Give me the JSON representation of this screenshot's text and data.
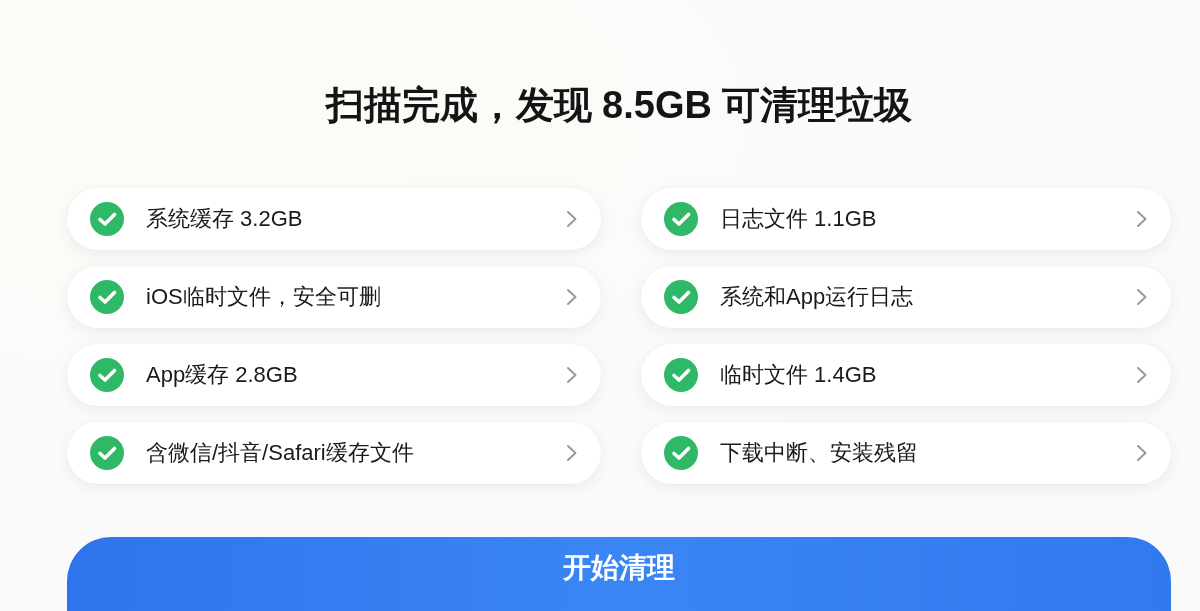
{
  "title": "扫描完成，发现 8.5GB 可清理垃圾",
  "items": [
    {
      "label": "系统缓存 3.2GB",
      "checked": true
    },
    {
      "label": "日志文件 1.1GB",
      "checked": true
    },
    {
      "label": "iOS临时文件，安全可删",
      "checked": true
    },
    {
      "label": "系统和App运行日志",
      "checked": true
    },
    {
      "label": "App缓存 2.8GB",
      "checked": true
    },
    {
      "label": "临时文件 1.4GB",
      "checked": true
    },
    {
      "label": "含微信/抖音/Safari缓存文件",
      "checked": true
    },
    {
      "label": "下载中断、安装残留",
      "checked": true
    }
  ],
  "button": {
    "label": "开始清理"
  }
}
